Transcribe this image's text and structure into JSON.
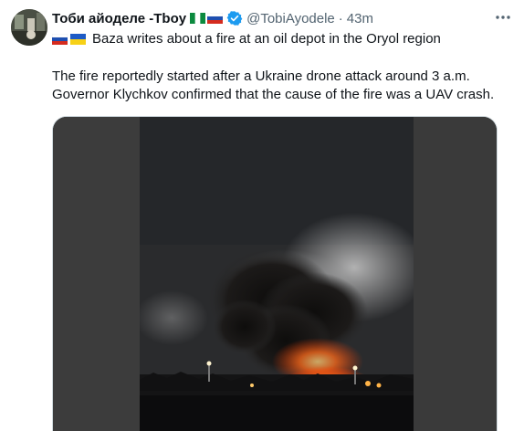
{
  "tweet": {
    "display_name": "Тоби айоделе -Tboy",
    "handle": "@TobiAyodele",
    "separator": "·",
    "time": "43m",
    "line1": "Baza writes about a fire at an oil depot in the Oryol region",
    "paragraph": "The fire reportedly started after a Ukraine drone attack around 3 a.m. Governor Klychkov confirmed that the cause of the fire was a UAV crash.",
    "name_flags": [
      "nigeria-flag",
      "russia-flag"
    ],
    "line1_flags": [
      "russia-flag",
      "ukraine-flag"
    ]
  },
  "icons": {
    "avatar": "avatar",
    "verified": "verified-badge-icon",
    "more": "more-options-icon"
  },
  "colors": {
    "text": "#0f1419",
    "secondary": "#536471",
    "verified": "#1d9bf0"
  }
}
